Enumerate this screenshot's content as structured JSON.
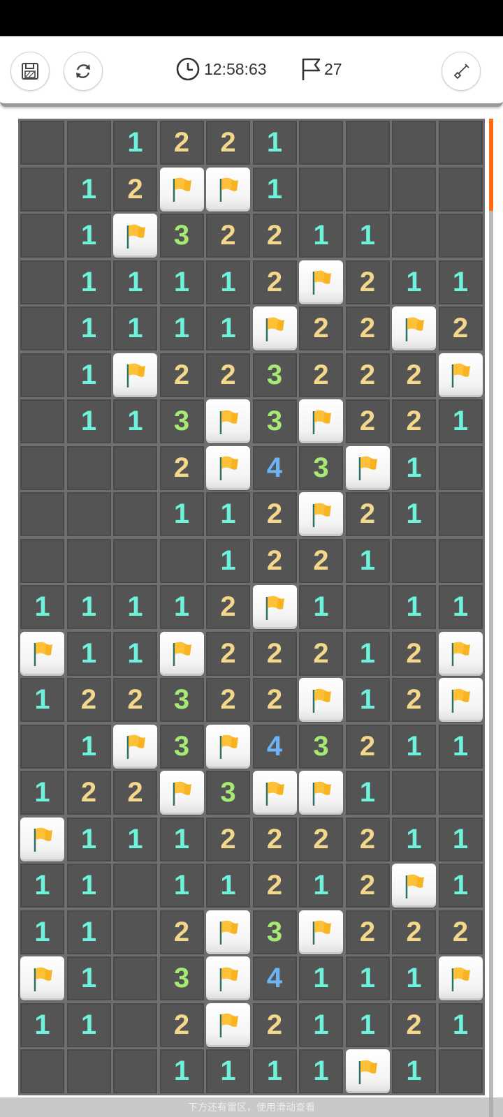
{
  "header": {
    "timer": "12:58:63",
    "flags_count": "27",
    "save_icon": "save-icon",
    "restart_icon": "restart-icon",
    "clock_icon": "clock-icon",
    "flag_icon": "flag-icon",
    "shovel_icon": "shovel-icon"
  },
  "board": {
    "columns": 10,
    "rows": [
      [
        "",
        "",
        "1",
        "2",
        "2",
        "1",
        "",
        "",
        "",
        ""
      ],
      [
        "",
        "1",
        "2",
        "F",
        "F",
        "1",
        "",
        "",
        "",
        ""
      ],
      [
        "",
        "1",
        "F",
        "3",
        "2",
        "2",
        "1",
        "1",
        "",
        ""
      ],
      [
        "",
        "1",
        "1",
        "1",
        "1",
        "2",
        "F",
        "2",
        "1",
        "1"
      ],
      [
        "",
        "1",
        "1",
        "1",
        "1",
        "F",
        "2",
        "2",
        "F",
        "2"
      ],
      [
        "",
        "1",
        "F",
        "2",
        "2",
        "3",
        "2",
        "2",
        "2",
        "F"
      ],
      [
        "",
        "1",
        "1",
        "3",
        "F",
        "3",
        "F",
        "2",
        "2",
        "1"
      ],
      [
        "",
        "",
        "",
        "2",
        "F",
        "4",
        "3",
        "F",
        "1",
        ""
      ],
      [
        "",
        "",
        "",
        "1",
        "1",
        "2",
        "F",
        "2",
        "1",
        ""
      ],
      [
        "",
        "",
        "",
        "",
        "1",
        "2",
        "2",
        "1",
        "",
        ""
      ],
      [
        "1",
        "1",
        "1",
        "1",
        "2",
        "F",
        "1",
        "",
        "1",
        "1"
      ],
      [
        "F",
        "1",
        "1",
        "F",
        "2",
        "2",
        "2",
        "1",
        "2",
        "F"
      ],
      [
        "1",
        "2",
        "2",
        "3",
        "2",
        "2",
        "F",
        "1",
        "2",
        "F"
      ],
      [
        "",
        "1",
        "F",
        "3",
        "F",
        "4",
        "3",
        "2",
        "1",
        "1"
      ],
      [
        "1",
        "2",
        "2",
        "F",
        "3",
        "F",
        "F",
        "1",
        "",
        ""
      ],
      [
        "F",
        "1",
        "1",
        "1",
        "2",
        "2",
        "2",
        "2",
        "1",
        "1"
      ],
      [
        "1",
        "1",
        "",
        "1",
        "1",
        "2",
        "1",
        "2",
        "F",
        "1"
      ],
      [
        "1",
        "1",
        "",
        "2",
        "F",
        "3",
        "F",
        "2",
        "2",
        "2"
      ],
      [
        "F",
        "1",
        "",
        "3",
        "F",
        "4",
        "1",
        "1",
        "1",
        "F"
      ],
      [
        "1",
        "1",
        "",
        "2",
        "F",
        "2",
        "1",
        "1",
        "2",
        "1"
      ],
      [
        "",
        "",
        "",
        "1",
        "1",
        "1",
        "1",
        "F",
        "1",
        ""
      ]
    ],
    "number_colors": {
      "1": "#6ef2dc",
      "2": "#f3d78a",
      "3": "#a6ea74",
      "4": "#6db4f4"
    },
    "flag_color": "#f7b320"
  },
  "footer": {
    "hint_text": "下方还有雷区，使用滑动查看"
  },
  "accent_color": "#ff6a13"
}
